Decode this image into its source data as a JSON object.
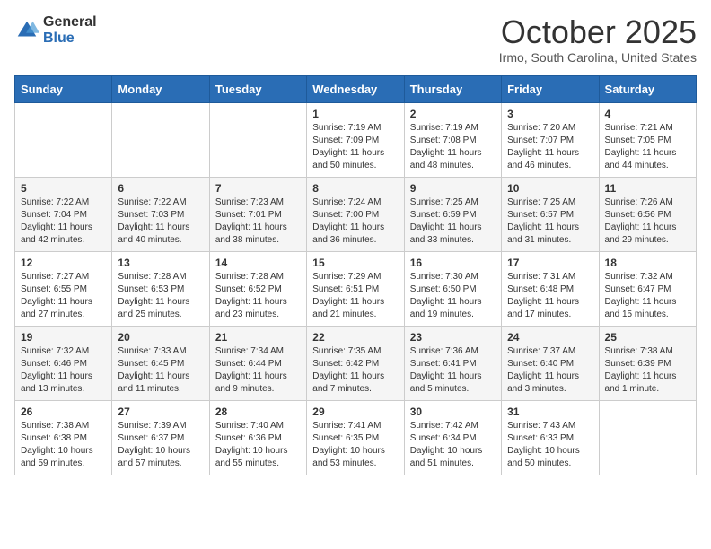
{
  "header": {
    "logo_general": "General",
    "logo_blue": "Blue",
    "month": "October 2025",
    "location": "Irmo, South Carolina, United States"
  },
  "weekdays": [
    "Sunday",
    "Monday",
    "Tuesday",
    "Wednesday",
    "Thursday",
    "Friday",
    "Saturday"
  ],
  "weeks": [
    [
      {
        "day": "",
        "sunrise": "",
        "sunset": "",
        "daylight": ""
      },
      {
        "day": "",
        "sunrise": "",
        "sunset": "",
        "daylight": ""
      },
      {
        "day": "",
        "sunrise": "",
        "sunset": "",
        "daylight": ""
      },
      {
        "day": "1",
        "sunrise": "Sunrise: 7:19 AM",
        "sunset": "Sunset: 7:09 PM",
        "daylight": "Daylight: 11 hours and 50 minutes."
      },
      {
        "day": "2",
        "sunrise": "Sunrise: 7:19 AM",
        "sunset": "Sunset: 7:08 PM",
        "daylight": "Daylight: 11 hours and 48 minutes."
      },
      {
        "day": "3",
        "sunrise": "Sunrise: 7:20 AM",
        "sunset": "Sunset: 7:07 PM",
        "daylight": "Daylight: 11 hours and 46 minutes."
      },
      {
        "day": "4",
        "sunrise": "Sunrise: 7:21 AM",
        "sunset": "Sunset: 7:05 PM",
        "daylight": "Daylight: 11 hours and 44 minutes."
      }
    ],
    [
      {
        "day": "5",
        "sunrise": "Sunrise: 7:22 AM",
        "sunset": "Sunset: 7:04 PM",
        "daylight": "Daylight: 11 hours and 42 minutes."
      },
      {
        "day": "6",
        "sunrise": "Sunrise: 7:22 AM",
        "sunset": "Sunset: 7:03 PM",
        "daylight": "Daylight: 11 hours and 40 minutes."
      },
      {
        "day": "7",
        "sunrise": "Sunrise: 7:23 AM",
        "sunset": "Sunset: 7:01 PM",
        "daylight": "Daylight: 11 hours and 38 minutes."
      },
      {
        "day": "8",
        "sunrise": "Sunrise: 7:24 AM",
        "sunset": "Sunset: 7:00 PM",
        "daylight": "Daylight: 11 hours and 36 minutes."
      },
      {
        "day": "9",
        "sunrise": "Sunrise: 7:25 AM",
        "sunset": "Sunset: 6:59 PM",
        "daylight": "Daylight: 11 hours and 33 minutes."
      },
      {
        "day": "10",
        "sunrise": "Sunrise: 7:25 AM",
        "sunset": "Sunset: 6:57 PM",
        "daylight": "Daylight: 11 hours and 31 minutes."
      },
      {
        "day": "11",
        "sunrise": "Sunrise: 7:26 AM",
        "sunset": "Sunset: 6:56 PM",
        "daylight": "Daylight: 11 hours and 29 minutes."
      }
    ],
    [
      {
        "day": "12",
        "sunrise": "Sunrise: 7:27 AM",
        "sunset": "Sunset: 6:55 PM",
        "daylight": "Daylight: 11 hours and 27 minutes."
      },
      {
        "day": "13",
        "sunrise": "Sunrise: 7:28 AM",
        "sunset": "Sunset: 6:53 PM",
        "daylight": "Daylight: 11 hours and 25 minutes."
      },
      {
        "day": "14",
        "sunrise": "Sunrise: 7:28 AM",
        "sunset": "Sunset: 6:52 PM",
        "daylight": "Daylight: 11 hours and 23 minutes."
      },
      {
        "day": "15",
        "sunrise": "Sunrise: 7:29 AM",
        "sunset": "Sunset: 6:51 PM",
        "daylight": "Daylight: 11 hours and 21 minutes."
      },
      {
        "day": "16",
        "sunrise": "Sunrise: 7:30 AM",
        "sunset": "Sunset: 6:50 PM",
        "daylight": "Daylight: 11 hours and 19 minutes."
      },
      {
        "day": "17",
        "sunrise": "Sunrise: 7:31 AM",
        "sunset": "Sunset: 6:48 PM",
        "daylight": "Daylight: 11 hours and 17 minutes."
      },
      {
        "day": "18",
        "sunrise": "Sunrise: 7:32 AM",
        "sunset": "Sunset: 6:47 PM",
        "daylight": "Daylight: 11 hours and 15 minutes."
      }
    ],
    [
      {
        "day": "19",
        "sunrise": "Sunrise: 7:32 AM",
        "sunset": "Sunset: 6:46 PM",
        "daylight": "Daylight: 11 hours and 13 minutes."
      },
      {
        "day": "20",
        "sunrise": "Sunrise: 7:33 AM",
        "sunset": "Sunset: 6:45 PM",
        "daylight": "Daylight: 11 hours and 11 minutes."
      },
      {
        "day": "21",
        "sunrise": "Sunrise: 7:34 AM",
        "sunset": "Sunset: 6:44 PM",
        "daylight": "Daylight: 11 hours and 9 minutes."
      },
      {
        "day": "22",
        "sunrise": "Sunrise: 7:35 AM",
        "sunset": "Sunset: 6:42 PM",
        "daylight": "Daylight: 11 hours and 7 minutes."
      },
      {
        "day": "23",
        "sunrise": "Sunrise: 7:36 AM",
        "sunset": "Sunset: 6:41 PM",
        "daylight": "Daylight: 11 hours and 5 minutes."
      },
      {
        "day": "24",
        "sunrise": "Sunrise: 7:37 AM",
        "sunset": "Sunset: 6:40 PM",
        "daylight": "Daylight: 11 hours and 3 minutes."
      },
      {
        "day": "25",
        "sunrise": "Sunrise: 7:38 AM",
        "sunset": "Sunset: 6:39 PM",
        "daylight": "Daylight: 11 hours and 1 minute."
      }
    ],
    [
      {
        "day": "26",
        "sunrise": "Sunrise: 7:38 AM",
        "sunset": "Sunset: 6:38 PM",
        "daylight": "Daylight: 10 hours and 59 minutes."
      },
      {
        "day": "27",
        "sunrise": "Sunrise: 7:39 AM",
        "sunset": "Sunset: 6:37 PM",
        "daylight": "Daylight: 10 hours and 57 minutes."
      },
      {
        "day": "28",
        "sunrise": "Sunrise: 7:40 AM",
        "sunset": "Sunset: 6:36 PM",
        "daylight": "Daylight: 10 hours and 55 minutes."
      },
      {
        "day": "29",
        "sunrise": "Sunrise: 7:41 AM",
        "sunset": "Sunset: 6:35 PM",
        "daylight": "Daylight: 10 hours and 53 minutes."
      },
      {
        "day": "30",
        "sunrise": "Sunrise: 7:42 AM",
        "sunset": "Sunset: 6:34 PM",
        "daylight": "Daylight: 10 hours and 51 minutes."
      },
      {
        "day": "31",
        "sunrise": "Sunrise: 7:43 AM",
        "sunset": "Sunset: 6:33 PM",
        "daylight": "Daylight: 10 hours and 50 minutes."
      },
      {
        "day": "",
        "sunrise": "",
        "sunset": "",
        "daylight": ""
      }
    ]
  ]
}
